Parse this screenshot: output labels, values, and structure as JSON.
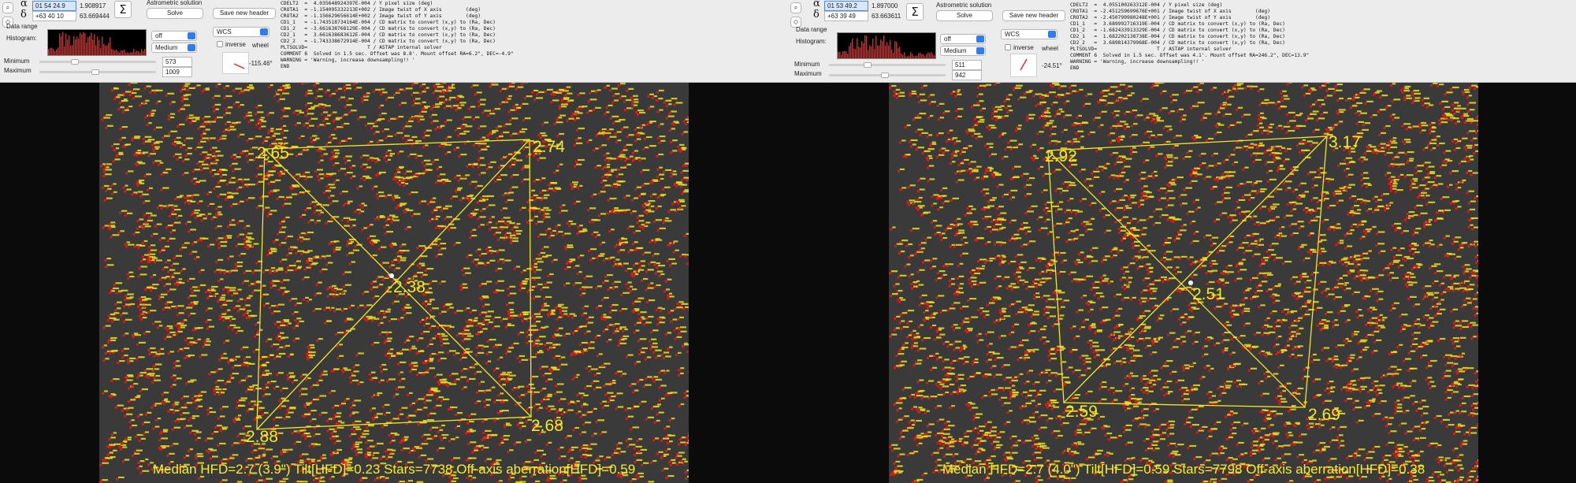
{
  "panels": [
    {
      "alpha_symbol": "α",
      "delta_symbol": "δ",
      "ra_value": "01 54 24.9",
      "ra_decimal": "1.908917",
      "dec_value": "+63 40 10",
      "dec_decimal": "63.669444",
      "sigma_label": "Σ",
      "astrometric_title": "Astrometric solution",
      "solve_label": "Solve",
      "save_header_label": "Save new header",
      "data_range_label": "Data range",
      "histogram_label": "Histogram:",
      "minimum_label": "Minimum",
      "maximum_label": "Maximum",
      "minimum_value": "573",
      "maximum_value": "1009",
      "dropdown_off": "off",
      "dropdown_medium": "Medium",
      "dropdown_wcs": "WCS",
      "inverse_label": "inverse",
      "wheel_label": "wheel",
      "angle": "-115.46°",
      "header_lines": [
        "CDELT2  =  4.035648924397E-004 / Y pixel size (deg)",
        "CROTA1  = -1.154095332213E+002 / Image twist of X axis        (deg)",
        "CROTA2  = -1.156629656614E+002 / Image twist of Y axis        (deg)",
        "CD1_1   = -1.743518734164E-004 / CD matrix to convert (x,y) to (Ra, Dec)",
        "CD1_2   = -3.661638768129E-004 / CD matrix to convert (x,y) to (Ra, Dec)",
        "CD2_1   =  3.661638683612E-004 / CD matrix to convert (x,y) to (Ra, Dec)",
        "CD2_2   = -1.743338672914E-004 / CD matrix to convert (x,y) to (Ra, Dec)",
        "PLTSOLVD=                    T / ASTAP internal solver",
        "COMMENT 6  Solved in 1.5 sec. Offset was 8.8'. Mount offset RA=6.2\", DEC=-4.9\"",
        "WARNING = 'Warning, increase downsampling!! '",
        "END"
      ],
      "hfd_center": "2.38",
      "hfd_tl": "2.65",
      "hfd_tr": "2.74",
      "hfd_bl": "2.88",
      "hfd_br": "2.68",
      "footer": "Median HFD=2.7 (3.9\")  Tilt[HFD]=0.23  Stars=7738  Off-axis aberration[HFD]=0.59"
    },
    {
      "alpha_symbol": "α",
      "delta_symbol": "δ",
      "ra_value": "01 53 49.2",
      "ra_decimal": "1.897000",
      "dec_value": "+63 39 49",
      "dec_decimal": "63.663611",
      "sigma_label": "Σ",
      "astrometric_title": "Astrometric solution",
      "solve_label": "Solve",
      "save_header_label": "Save new header",
      "data_range_label": "Data range",
      "histogram_label": "Histogram:",
      "minimum_label": "Minimum",
      "maximum_label": "Maximum",
      "minimum_value": "511",
      "maximum_value": "942",
      "dropdown_off": "off",
      "dropdown_medium": "Medium",
      "dropdown_wcs": "WCS",
      "inverse_label": "inverse",
      "wheel_label": "wheel",
      "angle": "-24.51°",
      "header_lines": [
        "CDELT2  =  4.055100263312E-004 / Y pixel size (deg)",
        "CROTA1  = -2.451259699676E+001 / Image twist of X axis        (deg)",
        "CROTA2  = -2.450799980248E+001 / Image twist of Y axis        (deg)",
        "CD1_1   =  3.689992716319E-004 / CD matrix to convert (x,y) to (Ra, Dec)",
        "CD1_2   = -1.682433913329E-004 / CD matrix to convert (x,y) to (Ra, Dec)",
        "CD2_1   =  1.682202138738E-004 / CD matrix to convert (x,y) to (Ra, Dec)",
        "CD2_2   =  3.689814379968E-004 / CD matrix to convert (x,y) to (Ra, Dec)",
        "PLTSOLVD=                    T / ASTAP internal solver",
        "COMMENT 6  Solved in 1.5 sec. Offset was 4.1'. Mount offset RA=246.2\", DEC=13.9\"",
        "WARNING = 'Warning, increase downsampling!! '",
        "END"
      ],
      "hfd_center": "2.51",
      "hfd_tl": "2.92",
      "hfd_tr": "3.17",
      "hfd_bl": "2.59",
      "hfd_br": "2.69",
      "footer": "Median HFD=2.7 (4.0\")  Tilt[HFD]=0.59  Stars=7798  Off-axis aberration[HFD]=0.38"
    }
  ],
  "colors": {
    "star_red": "#e81414",
    "label_yellow": "#e8e020",
    "tilt_lines": "#f0e826"
  }
}
